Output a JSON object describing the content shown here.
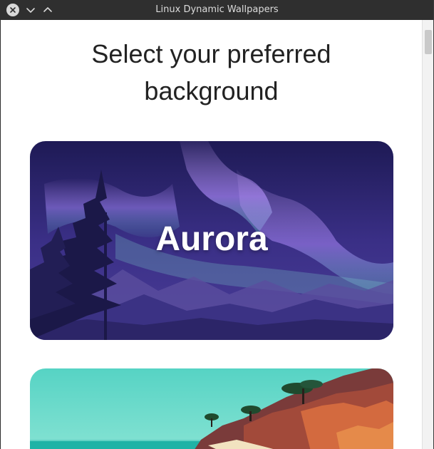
{
  "window": {
    "title": "Linux Dynamic Wallpapers"
  },
  "titlebar_buttons": {
    "close_icon": "close-icon",
    "minimize_icon": "chevron-down-icon",
    "maximize_icon": "chevron-up-icon"
  },
  "page": {
    "heading_line1": "Select your preferred",
    "heading_line2": "background"
  },
  "wallpapers": [
    {
      "label": "Aurora"
    },
    {
      "label": ""
    }
  ],
  "colors": {
    "titlebar": "#2f2f2f",
    "content_bg": "#ffffff",
    "heading_text": "#222222",
    "aurora_sky": "#2a2466",
    "aurora_glow": "#8a7cf0",
    "beach_sky": "#5fd6c8"
  }
}
